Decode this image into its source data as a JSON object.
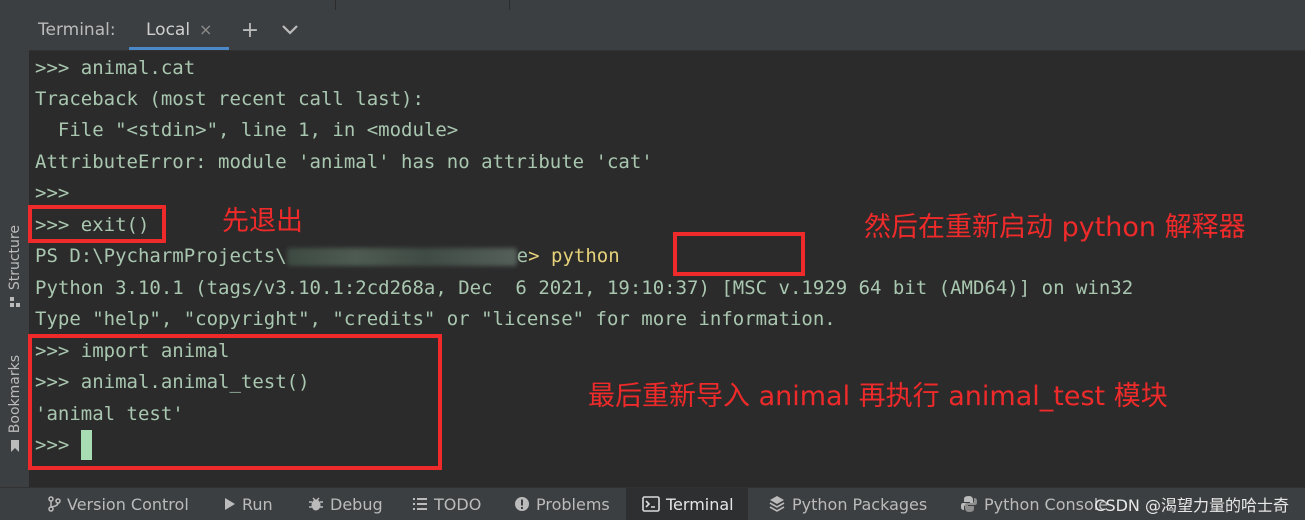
{
  "header": {
    "terminal_label": "Terminal:",
    "tab_label": "Local",
    "close_glyph": "×",
    "add_glyph": "+",
    "chevron_glyph": "⌄"
  },
  "terminal": {
    "lines": [
      ">>> animal.cat",
      "Traceback (most recent call last):",
      "  File \"<stdin>\", line 1, in <module>",
      "AttributeError: module 'animal' has no attribute 'cat'",
      ">>>",
      ">>> exit()",
      "PS D:\\PycharmProjects\\",
      "e",
      "> python",
      "Python 3.10.1 (tags/v3.10.1:2cd268a, Dec  6 2021, 19:10:37) [MSC v.1929 64 bit (AMD64)] on win32",
      "Type \"help\", \"copyright\", \"credits\" or \"license\" for more information.",
      ">>> import animal",
      ">>> animal.animal_test()",
      "'animal test'",
      ">>> "
    ]
  },
  "annotations": {
    "exit_note": "先退出",
    "restart_note": "然后在重新启动 python 解释器",
    "import_note": "最后重新导入 animal 再执行 animal_test 模块"
  },
  "left_stripe": {
    "structure": "Structure",
    "bookmarks": "Bookmarks"
  },
  "bottom_bar": {
    "version_control": "Version Control",
    "run": "Run",
    "debug": "Debug",
    "todo": "TODO",
    "problems": "Problems",
    "terminal": "Terminal",
    "python_packages": "Python Packages",
    "python_console": "Python Console"
  },
  "watermark": "CSDN @渴望力量的哈士奇",
  "colors": {
    "accent": "#4a88c7",
    "annotation_red": "#ee2a2a",
    "terminal_text": "#a9c7b0",
    "command_yellow": "#e6d27a"
  }
}
